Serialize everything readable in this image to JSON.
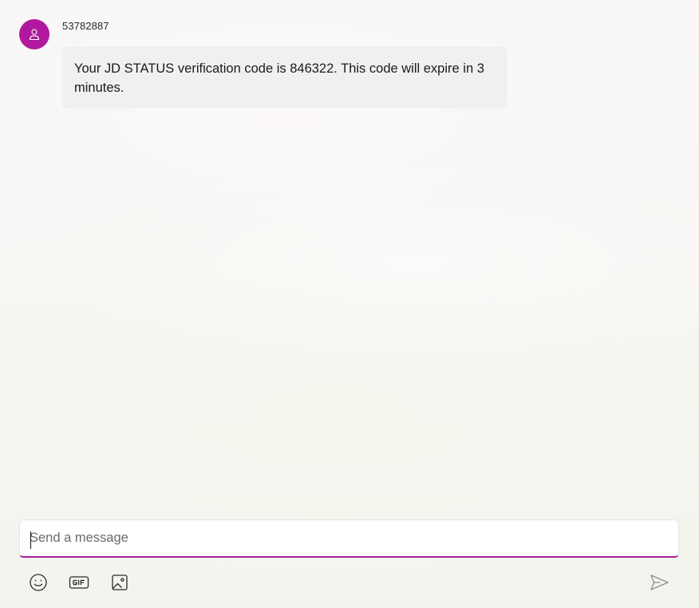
{
  "conversation": {
    "sender": "53782887",
    "messages": [
      {
        "text": "Your JD STATUS verification code is 846322. This code will expire in 3 minutes."
      }
    ]
  },
  "composer": {
    "placeholder": "Send a message",
    "value": ""
  },
  "toolbar": {
    "buttons": [
      {
        "icon": "emoji-icon"
      },
      {
        "icon": "gif-icon"
      },
      {
        "icon": "image-icon"
      },
      {
        "icon": "send-icon"
      }
    ]
  },
  "colors": {
    "avatar": "#b0199e",
    "composer_underline": "#a8209b",
    "bubble": "#f1f0f1"
  }
}
